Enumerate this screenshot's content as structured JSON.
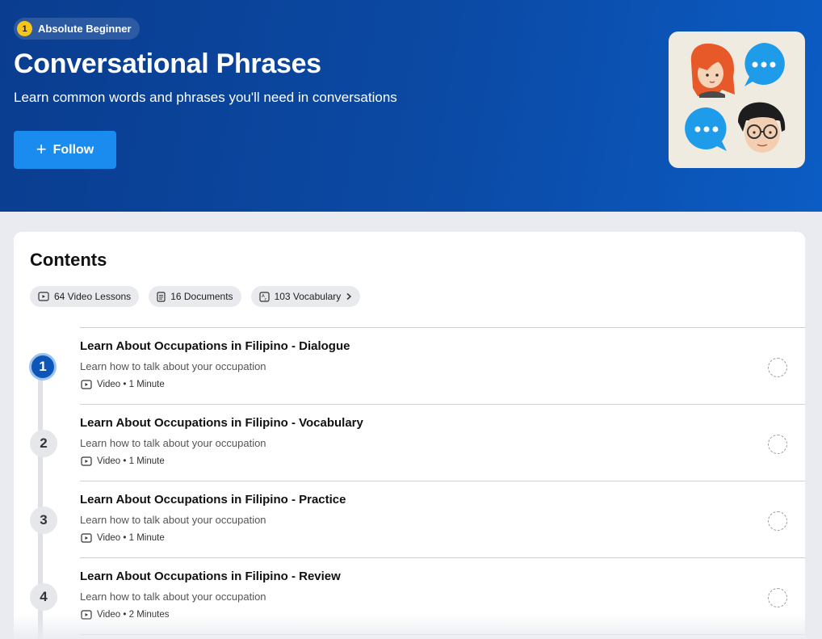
{
  "hero": {
    "level_number": "1",
    "level_label": "Absolute Beginner",
    "title": "Conversational Phrases",
    "subtitle": "Learn common words and phrases you'll need in conversations",
    "follow_label": "Follow"
  },
  "contents": {
    "title": "Contents",
    "chips": [
      {
        "label": "64 Video Lessons",
        "icon": "video-icon"
      },
      {
        "label": "16 Documents",
        "icon": "document-icon"
      },
      {
        "label": "103 Vocabulary",
        "icon": "vocabulary-icon"
      }
    ],
    "lessons": [
      {
        "number": "1",
        "title": "Learn About Occupations in Filipino - Dialogue",
        "description": "Learn how to talk about your occupation",
        "meta": "Video • 1 Minute"
      },
      {
        "number": "2",
        "title": "Learn About Occupations in Filipino - Vocabulary",
        "description": "Learn how to talk about your occupation",
        "meta": "Video • 1 Minute"
      },
      {
        "number": "3",
        "title": "Learn About Occupations in Filipino - Practice",
        "description": "Learn how to talk about your occupation",
        "meta": "Video • 1 Minute"
      },
      {
        "number": "4",
        "title": "Learn About Occupations in Filipino - Review",
        "description": "Learn how to talk about your occupation",
        "meta": "Video • 2 Minutes"
      }
    ]
  },
  "colors": {
    "hero_start": "#0a3d8f",
    "hero_end": "#0b5cc4",
    "accent": "#1a8cf0",
    "badge": "#f5c518",
    "active_step": "#0d56b8"
  }
}
